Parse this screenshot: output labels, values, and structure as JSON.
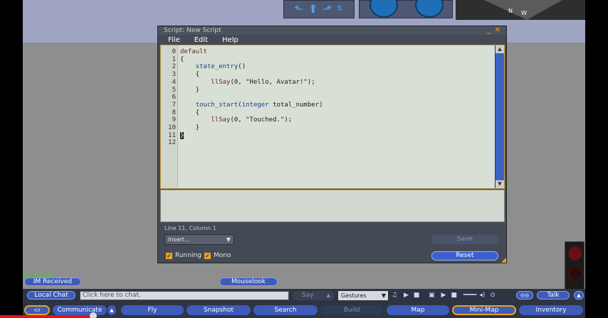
{
  "script_window": {
    "title": "Script: New Script",
    "menu": [
      "File",
      "Edit",
      "Help"
    ],
    "line_numbers": [
      "0",
      "1",
      "2",
      "3",
      "4",
      "5",
      "6",
      "7",
      "8",
      "9",
      "10",
      "11",
      "12"
    ],
    "code_lines": [
      {
        "segments": [
          {
            "t": "default",
            "c": "kw"
          }
        ]
      },
      {
        "segments": [
          {
            "t": "{",
            "c": ""
          }
        ]
      },
      {
        "segments": [
          {
            "t": "    ",
            "c": ""
          },
          {
            "t": "state_entry",
            "c": "fn"
          },
          {
            "t": "()",
            "c": ""
          }
        ]
      },
      {
        "segments": [
          {
            "t": "    {",
            "c": ""
          }
        ]
      },
      {
        "segments": [
          {
            "t": "        ",
            "c": ""
          },
          {
            "t": "llSay",
            "c": "kw"
          },
          {
            "t": "(0, \"Hello, Avatar!\");",
            "c": ""
          }
        ]
      },
      {
        "segments": [
          {
            "t": "    }",
            "c": ""
          }
        ]
      },
      {
        "segments": [
          {
            "t": "",
            "c": ""
          }
        ]
      },
      {
        "segments": [
          {
            "t": "    ",
            "c": ""
          },
          {
            "t": "touch_start",
            "c": "fn"
          },
          {
            "t": "(",
            "c": ""
          },
          {
            "t": "integer",
            "c": "ty"
          },
          {
            "t": " total_number)",
            "c": ""
          }
        ]
      },
      {
        "segments": [
          {
            "t": "    {",
            "c": ""
          }
        ]
      },
      {
        "segments": [
          {
            "t": "        ",
            "c": ""
          },
          {
            "t": "llSay",
            "c": "kw"
          },
          {
            "t": "(0, \"Touched.\");",
            "c": ""
          }
        ]
      },
      {
        "segments": [
          {
            "t": "    }",
            "c": ""
          }
        ]
      },
      {
        "segments": [
          {
            "t": "}",
            "c": "caret"
          }
        ]
      },
      {
        "segments": [
          {
            "t": "",
            "c": ""
          }
        ]
      }
    ],
    "status": "Line 11, Column 1",
    "insert_dropdown": "Insert...",
    "save_label": "Save",
    "reset_label": "Reset",
    "running_label": "Running",
    "mono_label": "Mono"
  },
  "minimap_labels": {
    "n": "N",
    "w": "W"
  },
  "bottom": {
    "im_indicator": "gil.A Willard",
    "im_received": "IM Received",
    "mouselook": "Mouselook",
    "local_chat": "Local Chat",
    "chat_placeholder": "Click here to chat.",
    "say": "Say",
    "gestures": "Gestures",
    "talk": "Talk",
    "tabs": [
      "Communicate",
      "Fly",
      "Snapshot",
      "Search",
      "Build",
      "Map",
      "Mini-Map",
      "Inventory"
    ]
  },
  "colors": {
    "accent": "#e8a024",
    "button_blue": "#3d5bb8",
    "editor_bg": "#d8e0d6"
  }
}
